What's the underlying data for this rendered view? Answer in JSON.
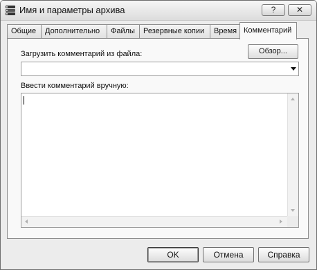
{
  "window": {
    "title": "Имя и параметры архива",
    "help_label": "?",
    "close_label": "✕",
    "icon": "winrar-books-icon"
  },
  "tabs": [
    {
      "label": "Общие",
      "active": false
    },
    {
      "label": "Дополнительно",
      "active": false
    },
    {
      "label": "Файлы",
      "active": false
    },
    {
      "label": "Резервные копии",
      "active": false
    },
    {
      "label": "Время",
      "active": false
    },
    {
      "label": "Комментарий",
      "active": true
    }
  ],
  "comment_tab": {
    "load_label": "Загрузить комментарий из файла:",
    "browse_label": "Обзор...",
    "file_value": "",
    "manual_label": "Ввести комментарий вручную:",
    "comment_value": ""
  },
  "footer": {
    "ok_label": "OK",
    "cancel_label": "Отмена",
    "help_label": "Справка"
  }
}
